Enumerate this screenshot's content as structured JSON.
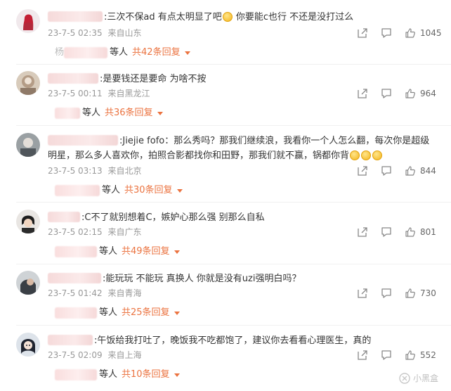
{
  "comments": [
    {
      "text": ":三次不保ad  有点太明显了吧",
      "text_after_emoji": " 你要能c也行 不还是没打过么",
      "time": "23-7-5 02:35",
      "location": "来自山东",
      "likes": "1045",
      "reply_total": "共42条回复",
      "reply_suffix": "等人",
      "reply_prefix": "杨",
      "emoji_count": 1
    },
    {
      "text": ":是要钱还是要命 为啥不按",
      "text_after_emoji": "",
      "time": "23-7-5 00:11",
      "location": "来自黑龙江",
      "likes": "964",
      "reply_total": "共36条回复",
      "reply_suffix": "等人",
      "reply_prefix": "",
      "emoji_count": 0
    },
    {
      "text": ":Jiejie fofo：那么秀吗？那我们继续浪，我看你一个人怎么翻，每次你是超级明星，那么多人喜欢你，拍照合影都找你和田野，那我们就不赢，锅都你背",
      "text_after_emoji": "",
      "time": "23-7-5 03:13",
      "location": "来自北京",
      "likes": "844",
      "reply_total": "共30条回复",
      "reply_suffix": "等人",
      "reply_prefix": "",
      "emoji_count": 3
    },
    {
      "text": ":C不了就别想着C，嫉妒心那么强 别那么自私",
      "text_after_emoji": "",
      "time": "23-7-5 02:15",
      "location": "来自广东",
      "likes": "801",
      "reply_total": "共49条回复",
      "reply_suffix": "等人",
      "reply_prefix": "",
      "emoji_count": 0
    },
    {
      "text": ":能玩玩 不能玩 真换人 你就是没有uzi强明白吗？",
      "text_after_emoji": "",
      "time": "23-7-5 01:42",
      "location": "来自青海",
      "likes": "730",
      "reply_total": "共25条回复",
      "reply_suffix": "等人",
      "reply_prefix": "",
      "emoji_count": 0
    },
    {
      "text": ":午饭给我打吐了，晚饭我不吃都饱了，建议你去看看心理医生，真的",
      "text_after_emoji": "",
      "time": "23-7-5 02:09",
      "location": "来自上海",
      "likes": "552",
      "reply_total": "共10条回复",
      "reply_suffix": "等人",
      "reply_prefix": "",
      "emoji_count": 0
    }
  ],
  "watermark": "小黑盒",
  "colors": {
    "accent": "#eb7340",
    "meta": "#999999"
  },
  "icons": [
    "share-icon",
    "comment-icon",
    "like-icon",
    "emoji-icon"
  ]
}
